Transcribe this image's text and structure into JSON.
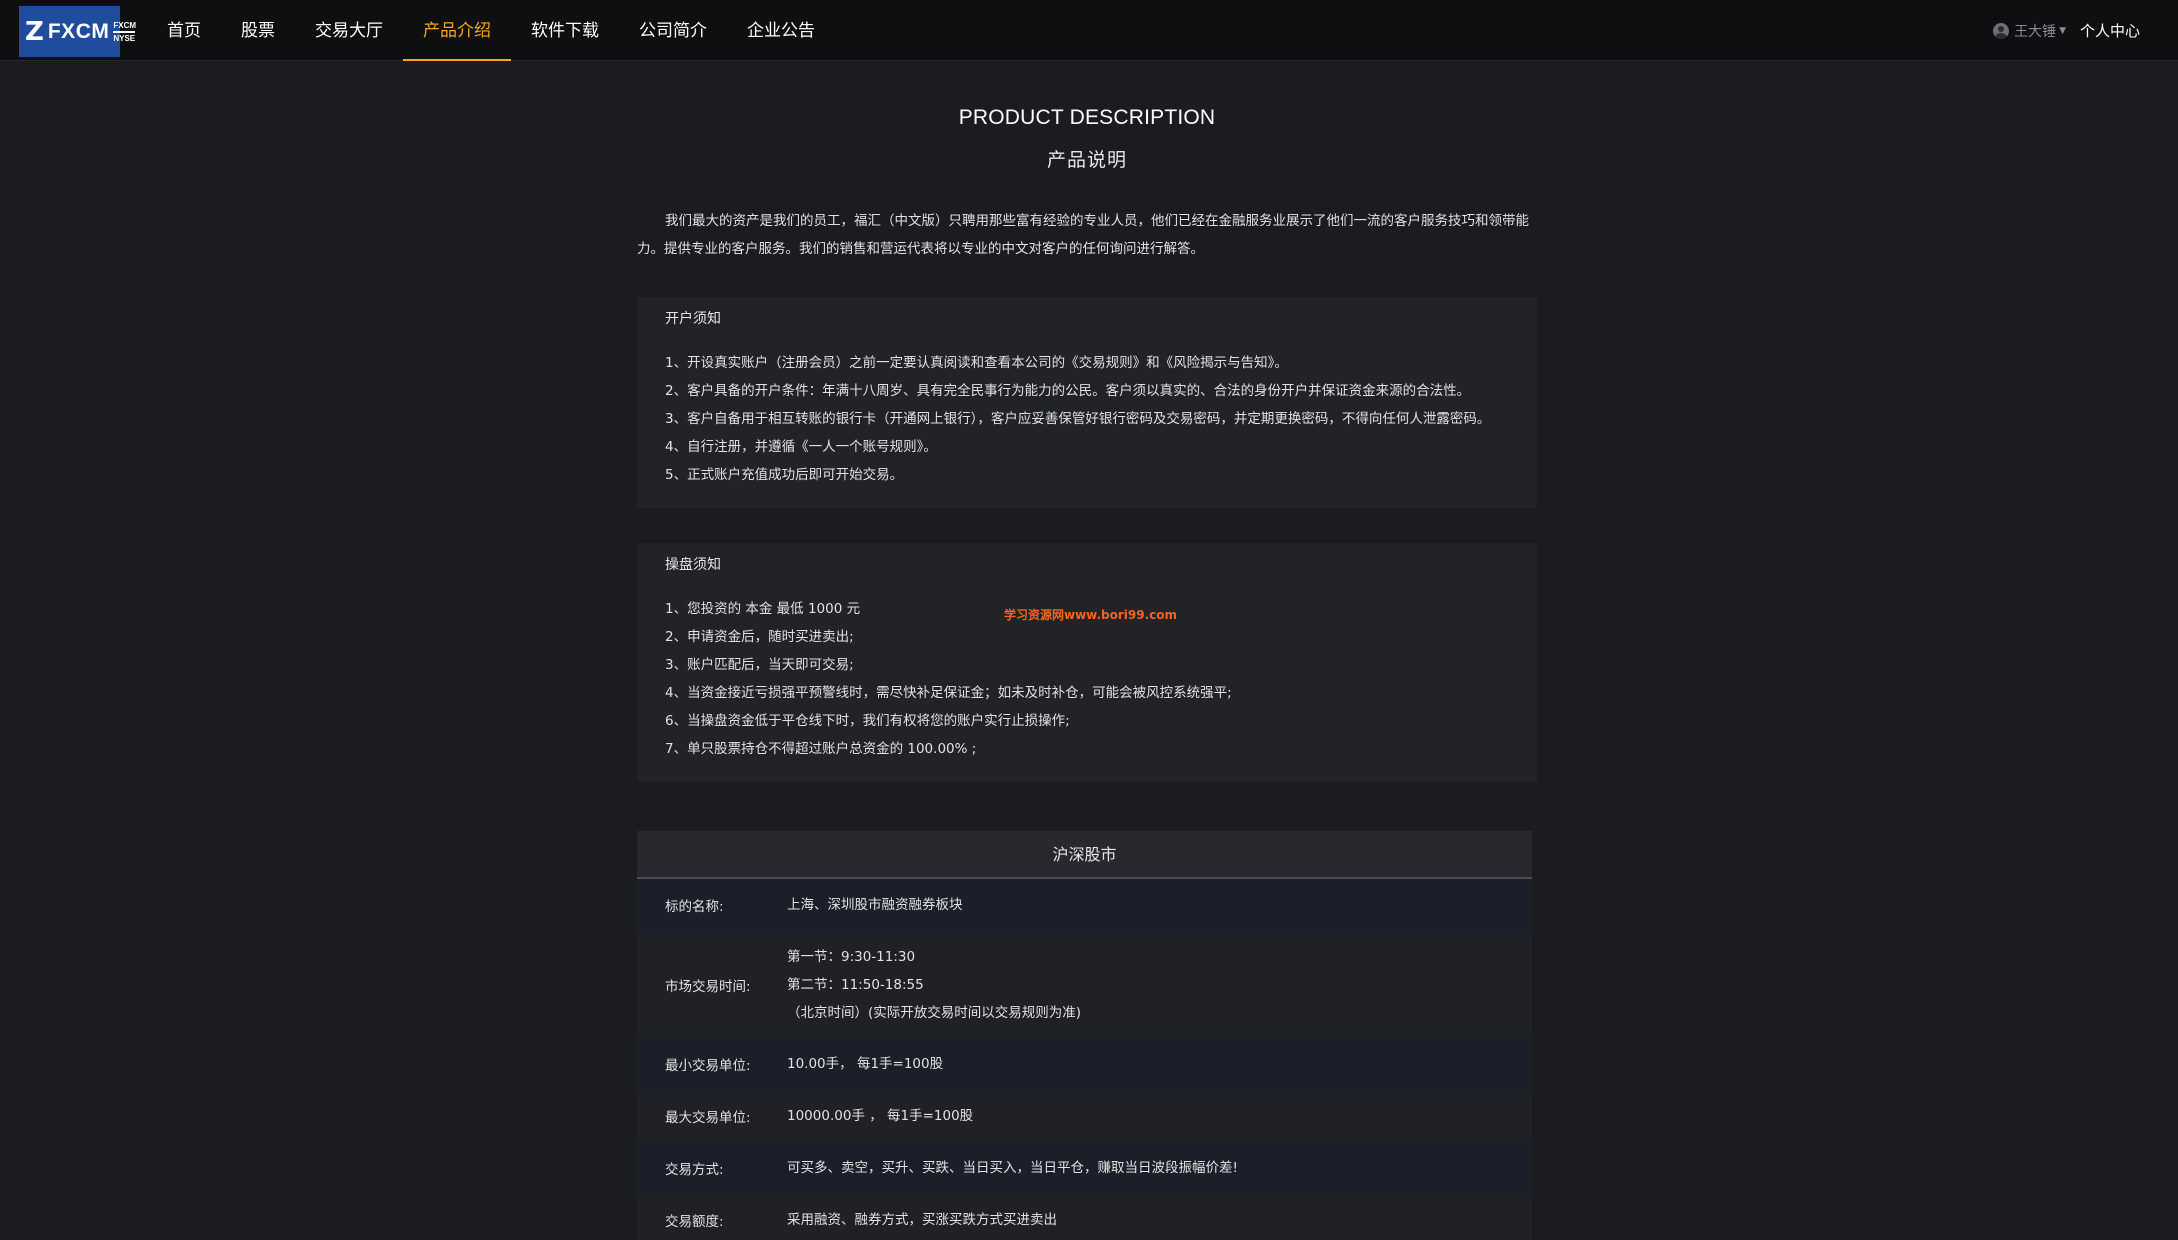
{
  "logo": {
    "mark": "Z",
    "text": "FXCM",
    "sub_top": "FXCM",
    "sub_bottom": "NYSE"
  },
  "nav": {
    "items": [
      {
        "label": "首页",
        "active": false
      },
      {
        "label": "股票",
        "active": false
      },
      {
        "label": "交易大厅",
        "active": false
      },
      {
        "label": "产品介绍",
        "active": true
      },
      {
        "label": "软件下载",
        "active": false
      },
      {
        "label": "公司简介",
        "active": false
      },
      {
        "label": "企业公告",
        "active": false
      }
    ],
    "user_name": "王大锤",
    "user_center": "个人中心"
  },
  "page": {
    "title_en": "PRODUCT DESCRIPTION",
    "title_cn": "产品说明",
    "intro": "我们最大的资产是我们的员工，福汇（中文版）只聘用那些富有经验的专业人员，他们已经在金融服务业展示了他们一流的客户服务技巧和领带能力。提供专业的客户服务。我们的销售和营运代表将以专业的中文对客户的任何询问进行解答。"
  },
  "account_notice": {
    "title": "开户须知",
    "items": [
      "1、开设真实账户（注册会员）之前一定要认真阅读和查看本公司的《交易规则》和《风险揭示与告知》。",
      "2、客户具备的开户条件：年满十八周岁、具有完全民事行为能力的公民。客户须以真实的、合法的身份开户并保证资金来源的合法性。",
      "3、客户自备用于相互转账的银行卡（开通网上银行），客户应妥善保管好银行密码及交易密码，并定期更换密码，不得向任何人泄露密码。",
      "4、自行注册，并遵循《一人一个账号规则》。",
      "5、正式账户充值成功后即可开始交易。"
    ]
  },
  "trading_notice": {
    "title": "操盘须知",
    "items": [
      "1、您投资的 本金 最低 1000 元",
      "2、申请资金后，随时买进卖出;",
      "3、账户匹配后，当天即可交易;",
      "4、当资金接近亏损强平预警线时，需尽快补足保证金；如未及时补仓，可能会被风控系统强平;",
      "6、当操盘资金低于平仓线下时，我们有权将您的账户实行止损操作;",
      "7、单只股票持仓不得超过账户总资金的 100.00% ;"
    ]
  },
  "watermark": "学习资源网www.bori99.com",
  "market": {
    "title": "沪深股市",
    "rows": [
      {
        "label": "标的名称:",
        "values": [
          "上海、深圳股市融资融券板块"
        ]
      },
      {
        "label": "市场交易时间:",
        "values": [
          "第一节：9:30-11:30",
          "第二节：11:50-18:55",
          "（北京时间）(实际开放交易时间以交易规则为准)"
        ]
      },
      {
        "label": "最小交易单位:",
        "values": [
          "10.00手， 每1手=100股"
        ]
      },
      {
        "label": "最大交易单位:",
        "values": [
          "10000.00手 ， 每1手=100股"
        ]
      },
      {
        "label": "交易方式:",
        "values": [
          "可买多、卖空，买升、买跌、当日买入，当日平仓，赚取当日波段振幅价差!"
        ]
      },
      {
        "label": "交易额度:",
        "values": [
          "采用融资、融券方式，买涨买跌方式买进卖出"
        ]
      }
    ]
  }
}
